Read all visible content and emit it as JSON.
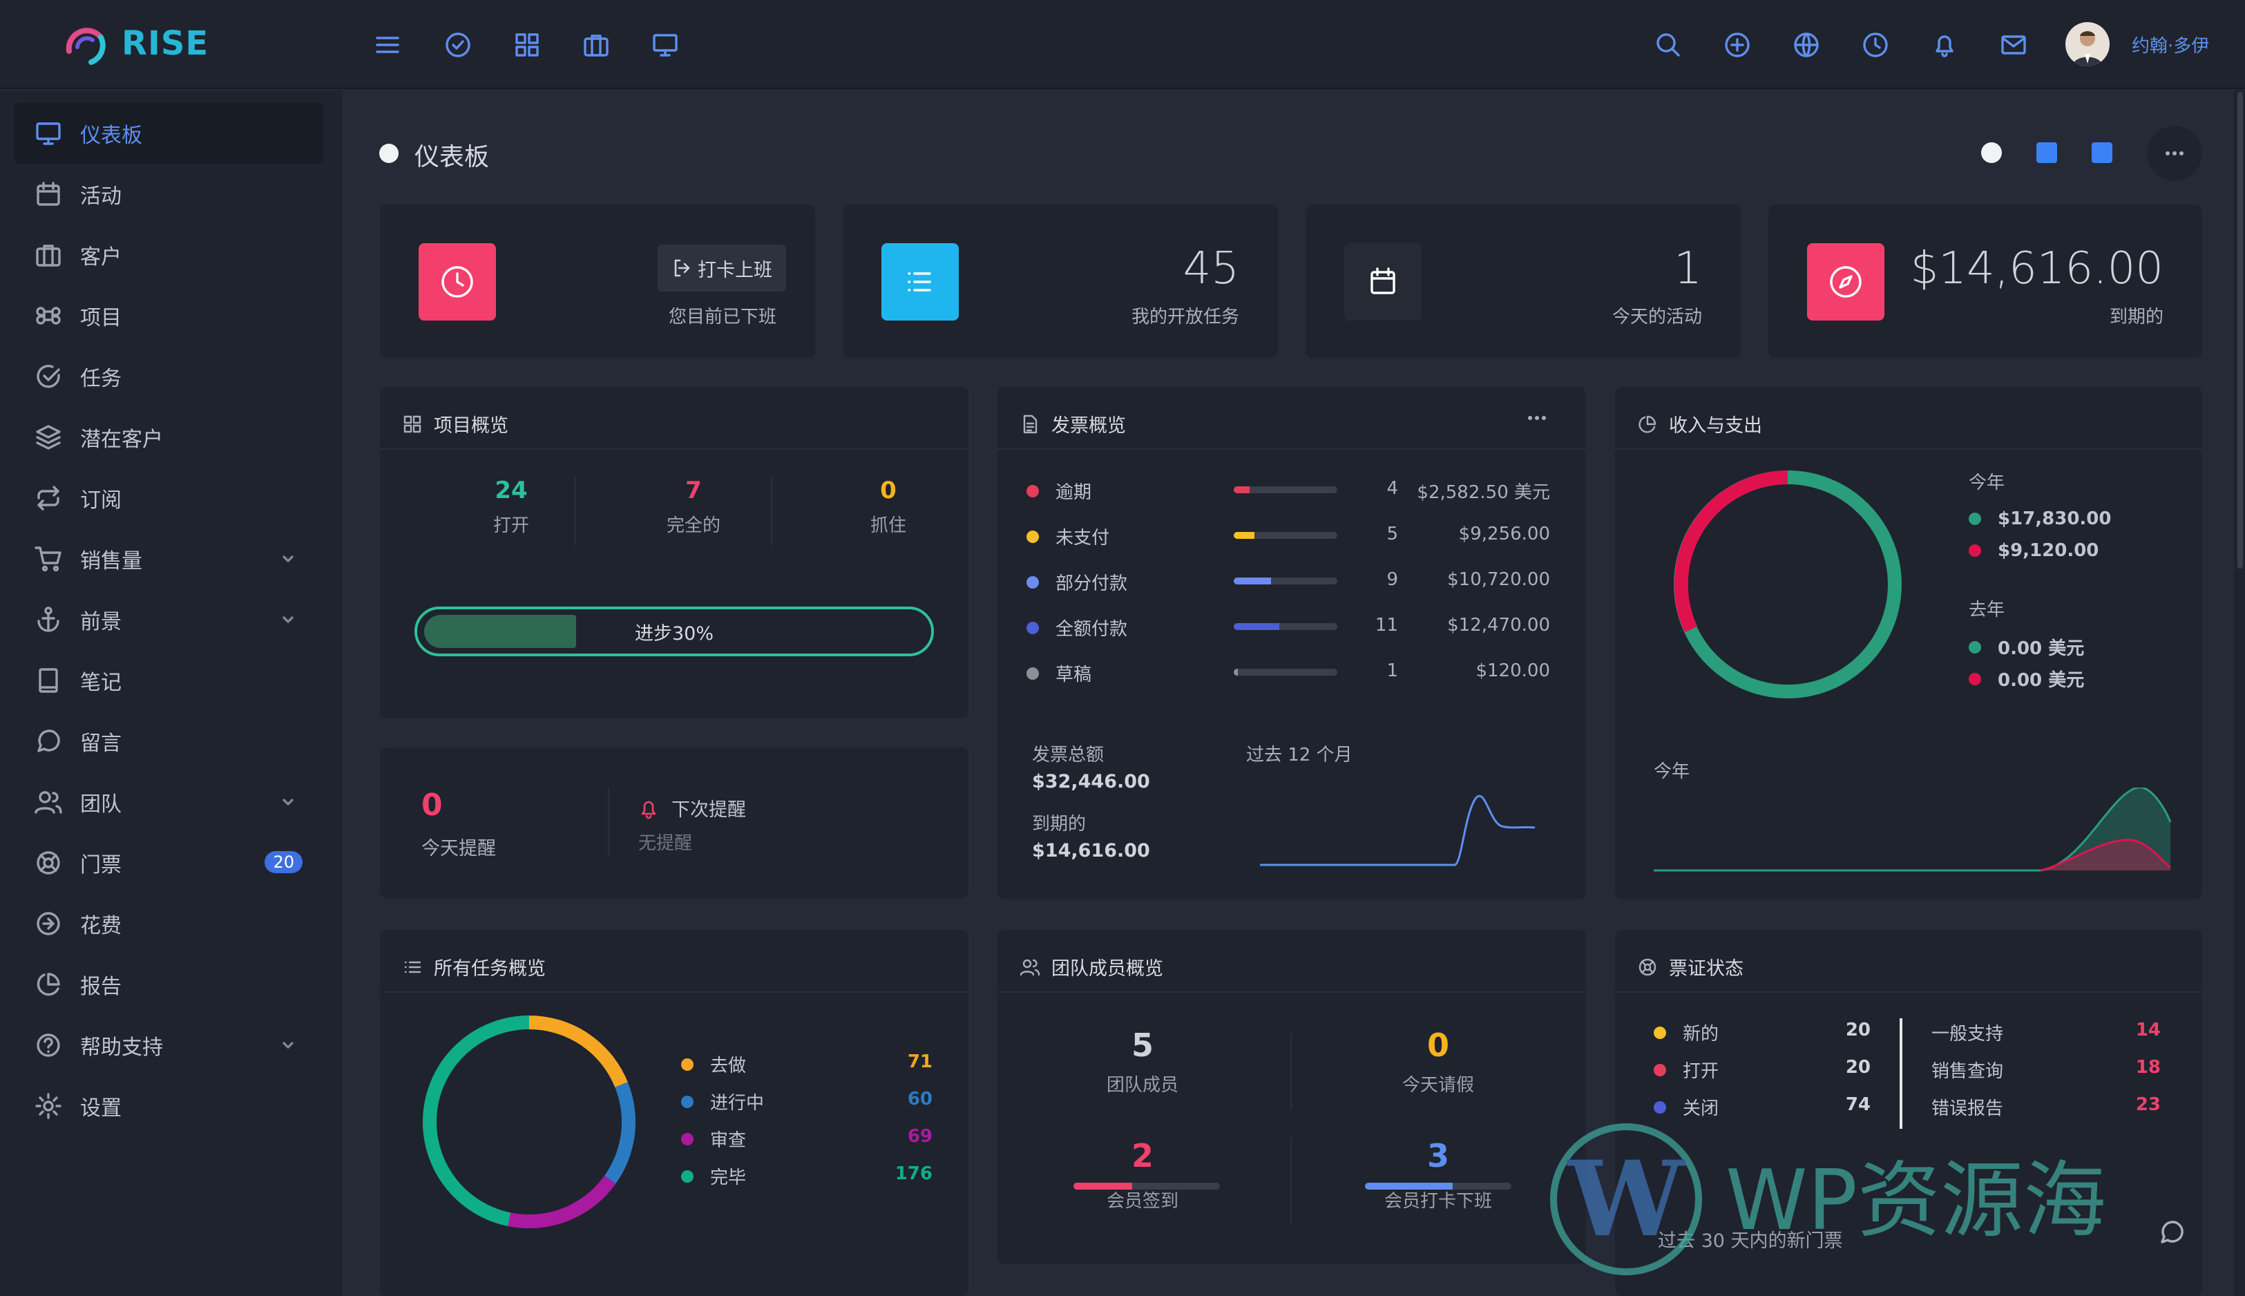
{
  "brand": {
    "name": "RISE"
  },
  "topbar": {
    "user_name": "约翰·多伊",
    "left_icons": [
      "menu-icon",
      "check-circle-icon",
      "grid-icon",
      "briefcase-icon",
      "monitor-icon"
    ],
    "right_icons": [
      "search-icon",
      "plus-circle-icon",
      "globe-icon",
      "clock-icon",
      "bell-icon",
      "mail-icon"
    ]
  },
  "sidebar": {
    "items": [
      {
        "label": "仪表板",
        "icon": "monitor-icon",
        "active": true
      },
      {
        "label": "活动",
        "icon": "calendar-icon"
      },
      {
        "label": "客户",
        "icon": "briefcase-icon"
      },
      {
        "label": "项目",
        "icon": "command-icon"
      },
      {
        "label": "任务",
        "icon": "check-circle-icon"
      },
      {
        "label": "潜在客户",
        "icon": "layers-icon"
      },
      {
        "label": "订阅",
        "icon": "repeat-icon"
      },
      {
        "label": "销售量",
        "icon": "cart-icon",
        "chevron": true
      },
      {
        "label": "前景",
        "icon": "anchor-icon",
        "chevron": true
      },
      {
        "label": "笔记",
        "icon": "book-icon"
      },
      {
        "label": "留言",
        "icon": "message-icon"
      },
      {
        "label": "团队",
        "icon": "users-icon",
        "chevron": true
      },
      {
        "label": "门票",
        "icon": "lifebuoy-icon",
        "badge": "20"
      },
      {
        "label": "花费",
        "icon": "arrow-circle-icon"
      },
      {
        "label": "报告",
        "icon": "pie-chart-icon"
      },
      {
        "label": "帮助支持",
        "icon": "help-circle-icon",
        "chevron": true
      },
      {
        "label": "设置",
        "icon": "settings-icon"
      }
    ]
  },
  "page": {
    "title": "仪表板"
  },
  "stats": {
    "clock": {
      "button": "打卡上班",
      "label": "您目前已下班"
    },
    "tasks": {
      "value": "45",
      "label": "我的开放任务"
    },
    "events": {
      "value": "1",
      "label": "今天的活动"
    },
    "due": {
      "value": "$14,616.00",
      "label": "到期的"
    }
  },
  "projects": {
    "title": "项目概览",
    "open": {
      "value": "24",
      "label": "打开"
    },
    "completed": {
      "value": "7",
      "label": "完全的"
    },
    "hold": {
      "value": "0",
      "label": "抓住"
    },
    "progress": {
      "label": "进步30%",
      "fraction": 0.3
    }
  },
  "reminders": {
    "today_value": "0",
    "today_label": "今天提醒",
    "next_title": "下次提醒",
    "next_value": "无提醒"
  },
  "invoices": {
    "title": "发票概览",
    "rows": [
      {
        "label": "逾期",
        "color": "#e53e5a",
        "fill": 0.15,
        "count": "4",
        "amount": "$2,582.50 美元"
      },
      {
        "label": "未支付",
        "color": "#f6c026",
        "fill": 0.2,
        "count": "5",
        "amount": "$9,256.00"
      },
      {
        "label": "部分付款",
        "color": "#6b8cf3",
        "fill": 0.36,
        "count": "9",
        "amount": "$10,720.00"
      },
      {
        "label": "全额付款",
        "color": "#4c5fd6",
        "fill": 0.44,
        "count": "11",
        "amount": "$12,470.00"
      },
      {
        "label": "草稿",
        "color": "#8d8f97",
        "fill": 0.04,
        "count": "1",
        "amount": "$120.00"
      }
    ],
    "total_label": "发票总额",
    "total_value": "$32,446.00",
    "due_label": "到期的",
    "due_value": "$14,616.00",
    "chart_label": "过去 12 个月"
  },
  "income": {
    "title": "收入与支出",
    "this_year_label": "今年",
    "this_year_income": "$17,830.00",
    "this_year_expense": "$9,120.00",
    "last_year_label": "去年",
    "last_year_income": "0.00 美元",
    "last_year_expense": "0.00 美元",
    "chart_label": "今年",
    "income_color": "#2a9d7c",
    "expense_color": "#e0124e"
  },
  "tasks_overview": {
    "title": "所有任务概览",
    "items": [
      {
        "label": "去做",
        "value": "71",
        "color": "#f6a623"
      },
      {
        "label": "进行中",
        "value": "60",
        "color": "#2b7bc2"
      },
      {
        "label": "审查",
        "value": "69",
        "color": "#a91aa0"
      },
      {
        "label": "完毕",
        "value": "176",
        "color": "#0fae88"
      }
    ]
  },
  "team": {
    "title": "团队成员概览",
    "members": {
      "value": "5",
      "label": "团队成员"
    },
    "leave": {
      "value": "0",
      "label": "今天请假"
    },
    "signin": {
      "value": "2",
      "label": "会员签到",
      "fraction": 0.4
    },
    "clockout": {
      "value": "3",
      "label": "会员打卡下班",
      "fraction": 0.6
    }
  },
  "tickets": {
    "title": "票证状态",
    "left": [
      {
        "label": "新的",
        "value": "20",
        "color": "#f6c026"
      },
      {
        "label": "打开",
        "value": "20",
        "color": "#e53e5a"
      },
      {
        "label": "关闭",
        "value": "74",
        "color": "#4c5fd6"
      }
    ],
    "right": [
      {
        "label": "一般支持",
        "value": "14"
      },
      {
        "label": "销售查询",
        "value": "18"
      },
      {
        "label": "错误报告",
        "value": "23"
      }
    ],
    "footer": "过去 30 天内的新门票"
  },
  "watermark": "WP资源海"
}
